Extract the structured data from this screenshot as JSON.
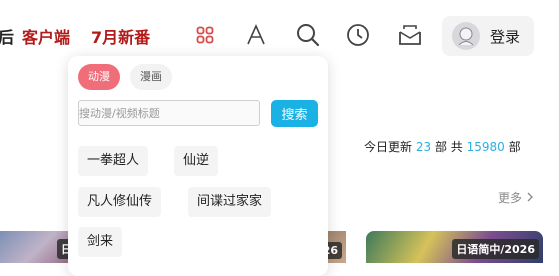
{
  "header": {
    "nav_cut_label": "后",
    "nav_links": [
      "客户端",
      "7月新番"
    ],
    "icons": [
      "grid-icon",
      "font-icon",
      "search-icon",
      "history-icon",
      "inbox-icon"
    ],
    "login_label": "登录",
    "accent_color": "#b31b1b"
  },
  "search_dropdown": {
    "tabs": [
      "动漫",
      "漫画"
    ],
    "active_tab": "动漫",
    "placeholder": "搜动漫/视频标题",
    "search_button": "搜索",
    "suggestions": [
      "一拳超人",
      "仙逆",
      "凡人修仙传",
      "间谍过家家",
      "剑来"
    ]
  },
  "stats": {
    "today_label": "今日更新",
    "today_count": "23",
    "unit1": "部",
    "total_label": "共",
    "total_count": "15980",
    "unit2": "部"
  },
  "more_label": "更多",
  "thumbnails": [
    {
      "badge": "日"
    },
    {
      "badge": "26"
    },
    {
      "badge": "日语简中/2026"
    }
  ]
}
